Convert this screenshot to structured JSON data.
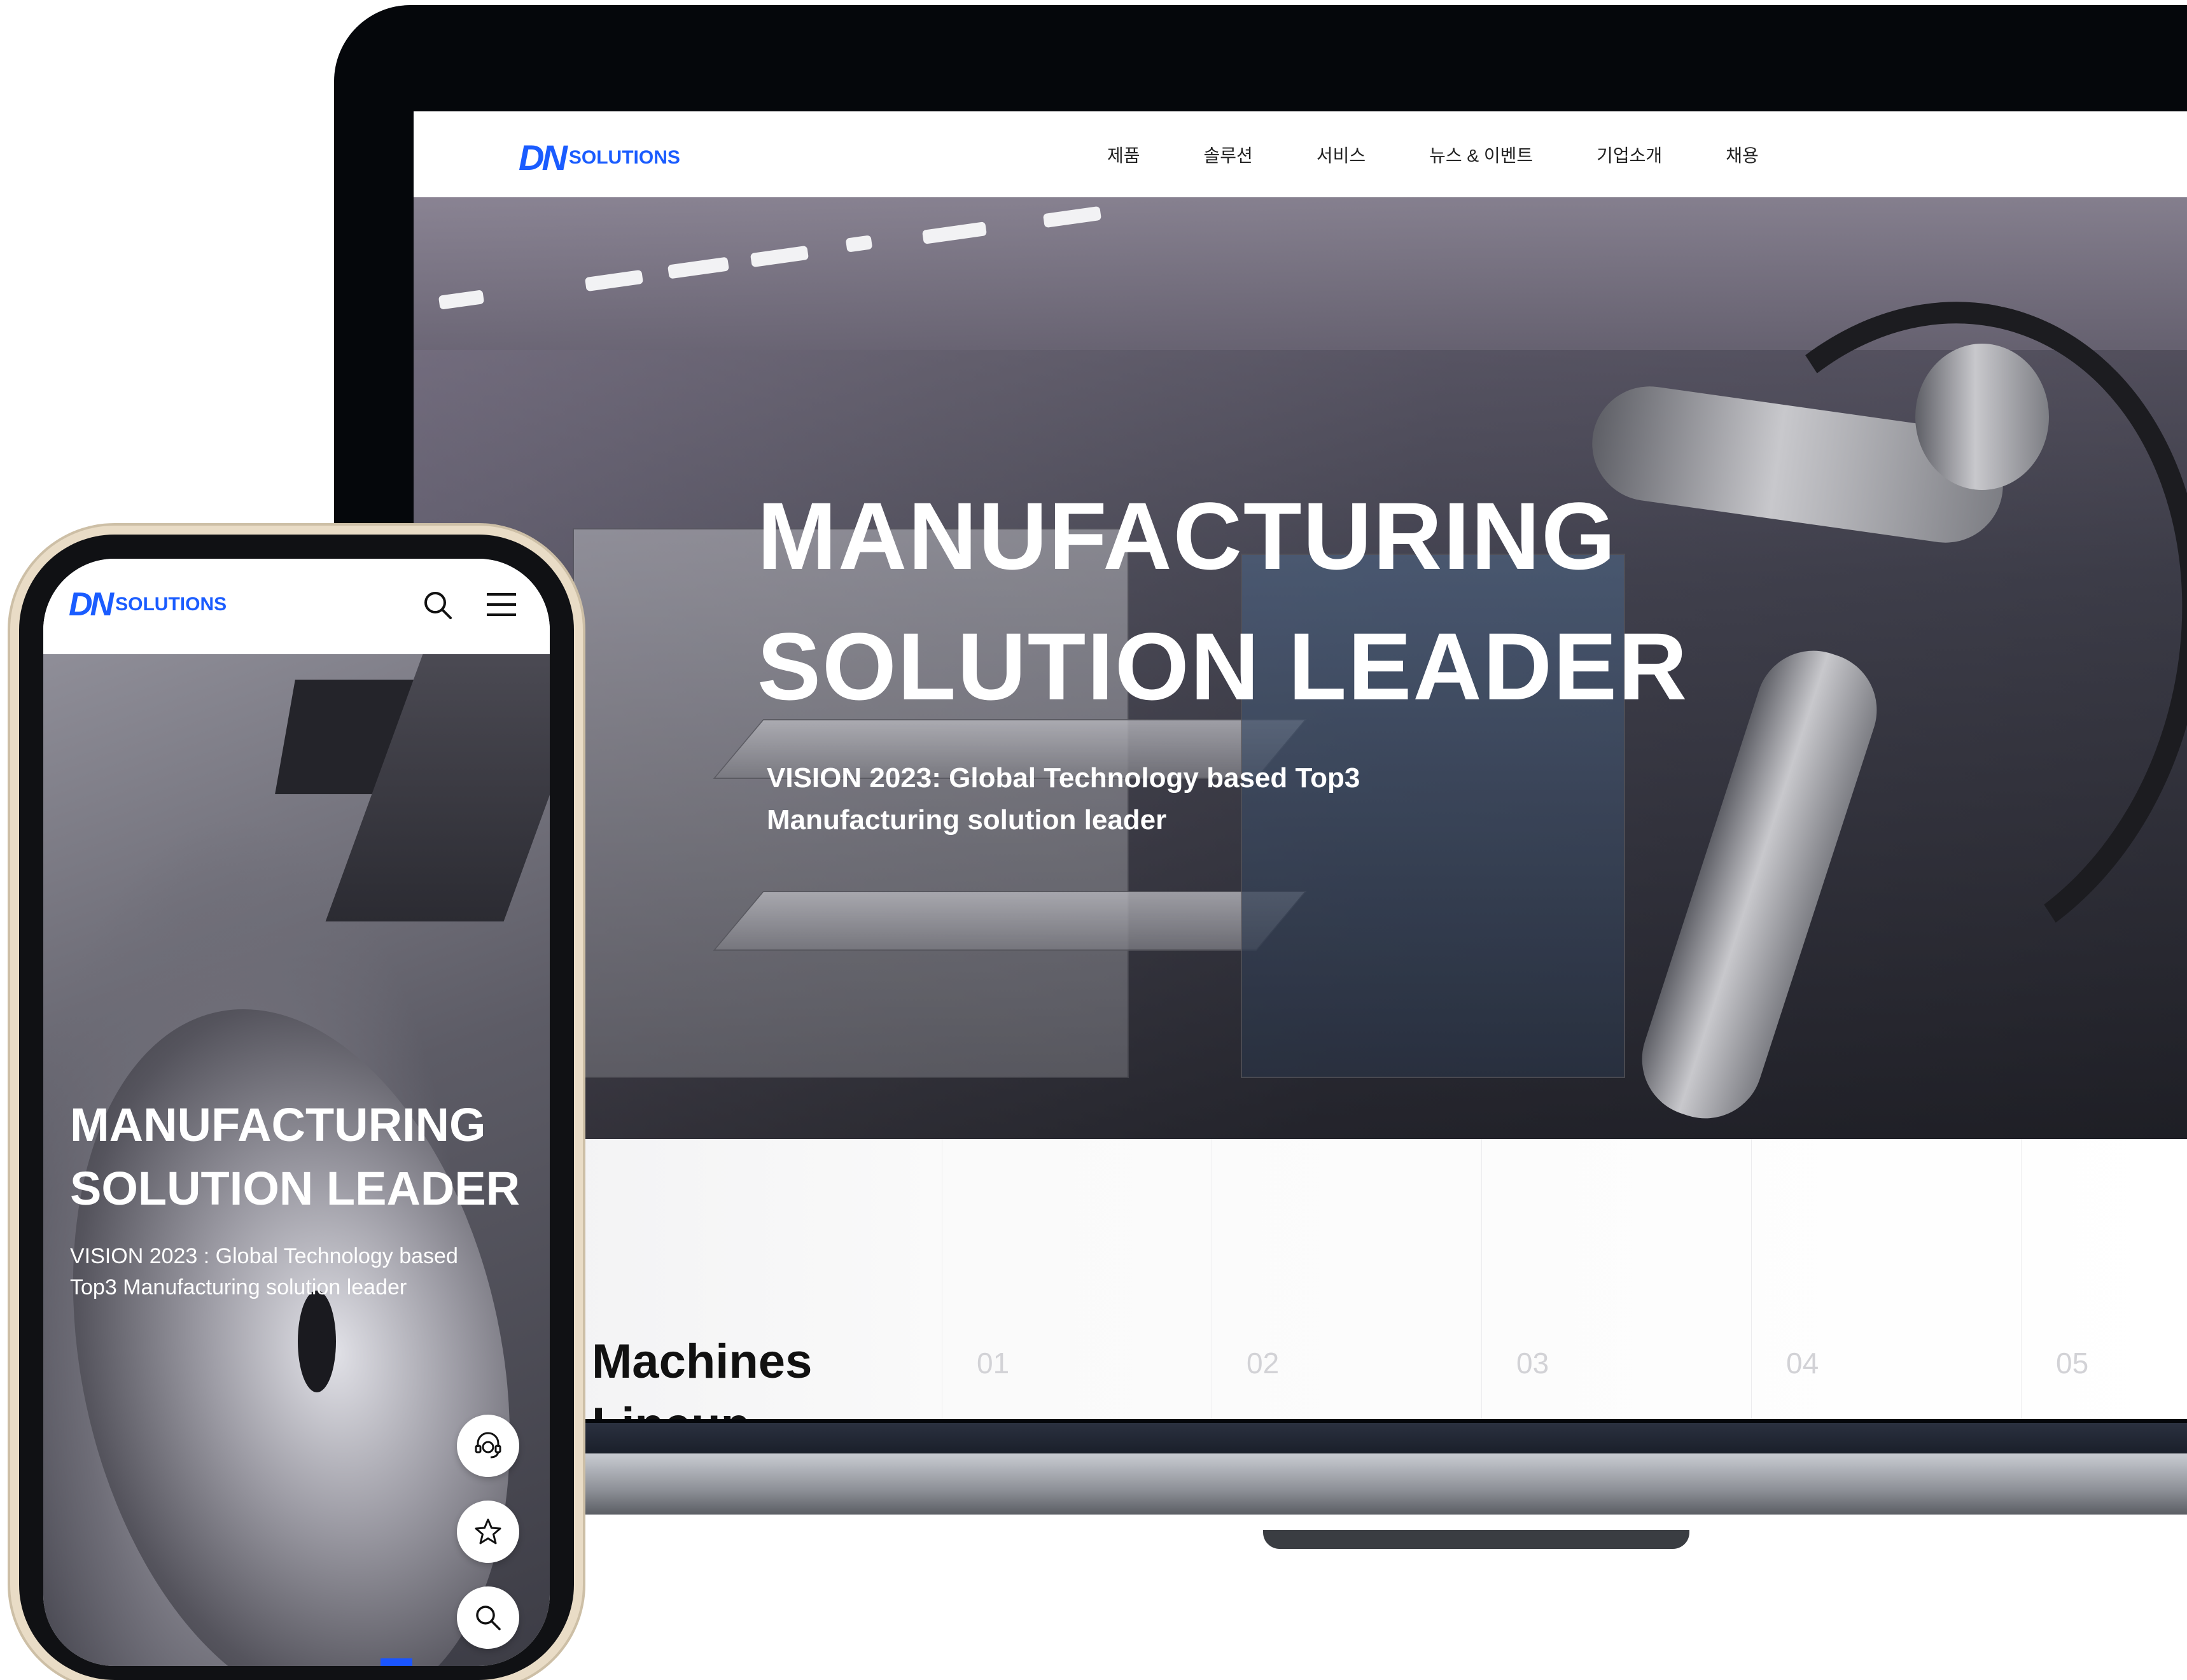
{
  "brand": {
    "mark": "DN",
    "name": "SOLUTIONS",
    "color": "#1a5cff"
  },
  "desktop": {
    "nav": [
      "제품",
      "솔루션",
      "서비스",
      "뉴스 & 이벤트",
      "기업소개",
      "채용"
    ],
    "hero": {
      "title_line1": "MANUFACTURING",
      "title_line2": "SOLUTION LEADER",
      "subtitle_line1": "VISION 2023: Global Technology based Top3",
      "subtitle_line2": "Manufacturing solution leader",
      "prev_icon": "chevron-left-icon",
      "next_icon": "chevron-right-icon",
      "pause_label": "II",
      "slide_progress": 0.2
    },
    "lineup": {
      "title": "Machines Lineup",
      "numbers": [
        "01",
        "02",
        "03",
        "04",
        "05"
      ]
    }
  },
  "mobile": {
    "icons": [
      "search-icon",
      "menu-icon"
    ],
    "hero": {
      "title_line1": "MANUFACTURING",
      "title_line2": "SOLUTION LEADER",
      "subtitle": "VISION 2023 : Global Technology based Top3 Manufacturing solution leader",
      "pause_label": "II"
    },
    "floating_buttons": [
      "support-agent-icon",
      "star-icon",
      "search-icon",
      "arrow-up-icon"
    ]
  },
  "colors": {
    "accent": "#1a55ff",
    "text_dark": "#111111"
  }
}
